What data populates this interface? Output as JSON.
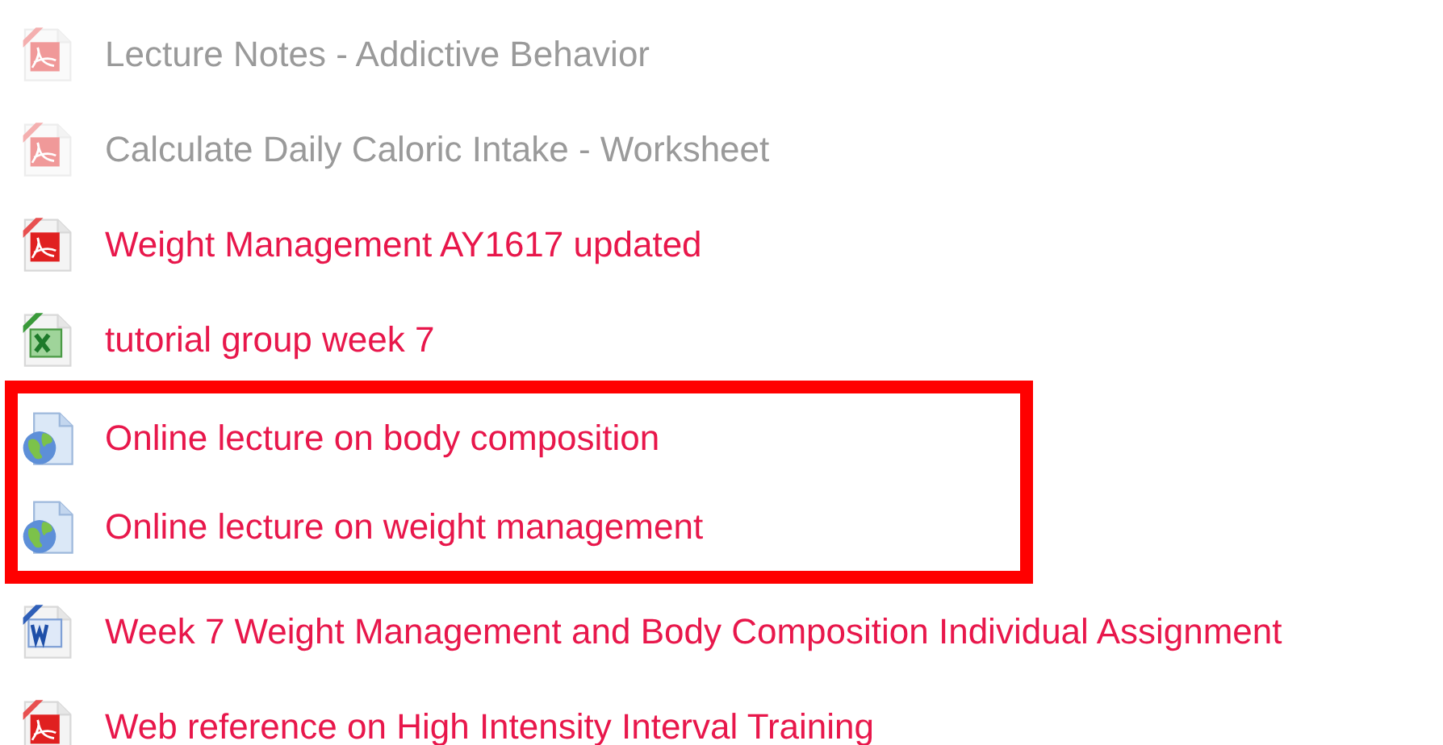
{
  "items": [
    {
      "kind": "pdf",
      "label": "Lecture Notes - Addictive Behavior",
      "dimmed": true
    },
    {
      "kind": "pdf",
      "label": "Calculate Daily Caloric Intake - Worksheet",
      "dimmed": true
    },
    {
      "kind": "pdf",
      "label": "Weight Management AY1617 updated",
      "dimmed": false
    },
    {
      "kind": "spreadsheet",
      "label": "tutorial group week 7",
      "dimmed": false
    },
    {
      "kind": "highlight_frame",
      "items": [
        {
          "kind": "url",
          "label": "Online lecture on body composition",
          "dimmed": false
        },
        {
          "kind": "url",
          "label": "Online lecture on weight management",
          "dimmed": false
        }
      ]
    },
    {
      "kind": "document",
      "label": "Week 7 Weight Management and Body Composition Individual Assignment",
      "dimmed": false
    },
    {
      "kind": "pdf",
      "label": "Web reference on High Intensity Interval Training",
      "dimmed": false
    }
  ]
}
